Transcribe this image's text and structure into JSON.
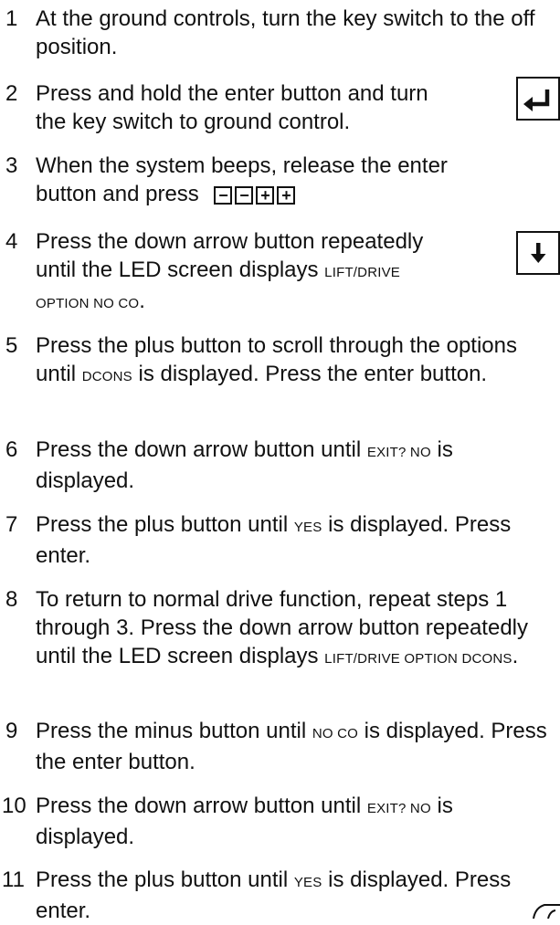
{
  "steps": [
    {
      "num": "1",
      "parts": [
        {
          "t": "At the ground controls, turn the key switch to the off position."
        }
      ]
    },
    {
      "num": "2",
      "parts": [
        {
          "t": "Press and hold the enter button and turn the key switch to ground control."
        }
      ]
    },
    {
      "num": "3",
      "parts": [
        {
          "t": "When the system beeps, release the enter button and press"
        }
      ]
    },
    {
      "num": "4",
      "parts": [
        {
          "t": "Press the down arrow button repeatedly until the LED screen displays "
        },
        {
          "sc": "LIFT/DRIVE OPTION NO CO"
        },
        {
          "t": "."
        }
      ]
    },
    {
      "num": "5",
      "parts": [
        {
          "t": "Press the plus button to scroll through the options until "
        },
        {
          "sc": "DCONS"
        },
        {
          "t": " is displayed. Press the enter button."
        }
      ]
    },
    {
      "num": "6",
      "parts": [
        {
          "t": "Press the down arrow button until "
        },
        {
          "sc": "EXIT? NO"
        },
        {
          "t": " is displayed."
        }
      ]
    },
    {
      "num": "7",
      "parts": [
        {
          "t": "Press the plus button until "
        },
        {
          "sc": "YES"
        },
        {
          "t": " is displayed. Press enter."
        }
      ]
    },
    {
      "num": "8",
      "parts": [
        {
          "t": "To return to normal drive function, repeat steps 1 through 3. Press the down arrow button repeatedly until the LED screen displays "
        },
        {
          "sc": "LIFT/DRIVE OPTION DCONS"
        },
        {
          "t": "."
        }
      ]
    },
    {
      "num": "9",
      "parts": [
        {
          "t": "Press the minus button until "
        },
        {
          "sc": "NO CO"
        },
        {
          "t": " is displayed. Press the enter button."
        }
      ]
    },
    {
      "num": "10",
      "parts": [
        {
          "t": "Press the down arrow button until "
        },
        {
          "sc": "EXIT? NO"
        },
        {
          "t": " is displayed."
        }
      ]
    },
    {
      "num": "11",
      "parts": [
        {
          "t": "Press the plus button until "
        },
        {
          "sc": "YES"
        },
        {
          "t": " is displayed. Press enter."
        }
      ]
    }
  ],
  "button_sequence": [
    "−",
    "−",
    "+",
    "+"
  ],
  "icons": {
    "enter": "enter-icon",
    "down": "down-arrow-icon",
    "corner": "page-corner-icon"
  }
}
